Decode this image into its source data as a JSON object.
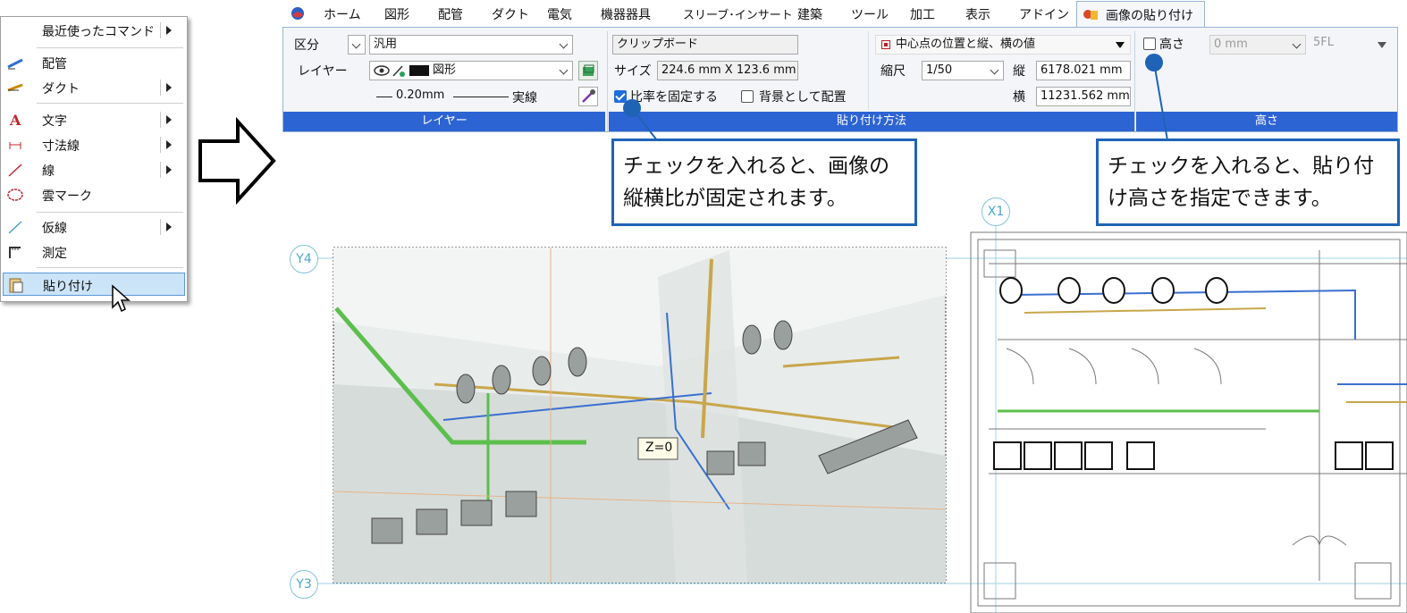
{
  "context_menu": {
    "items": [
      {
        "label": "最近使ったコマンド",
        "submenu": true
      },
      {
        "label": "配管",
        "submenu": false
      },
      {
        "label": "ダクト",
        "submenu": true
      },
      {
        "label": "文字",
        "submenu": true
      },
      {
        "label": "寸法線",
        "submenu": true
      },
      {
        "label": "線",
        "submenu": true
      },
      {
        "label": "雲マーク",
        "submenu": false
      },
      {
        "label": "仮線",
        "submenu": true
      },
      {
        "label": "測定",
        "submenu": false
      },
      {
        "label": "貼り付け",
        "submenu": false
      }
    ]
  },
  "ribbon": {
    "tabs": [
      "ホーム",
      "図形",
      "配管",
      "ダクト",
      "電気",
      "機器器具",
      "スリーブ･インサート",
      "建築",
      "ツール",
      "加工",
      "表示",
      "アドイン"
    ],
    "active_tab": "画像の貼り付け",
    "layer_group": {
      "title": "レイヤー",
      "kubun_label": "区分",
      "kubun_value": "汎用",
      "layer_label": "レイヤー",
      "layer_value": "図形",
      "line_width": "0.20mm",
      "line_type": "実線"
    },
    "paste_group": {
      "title": "貼り付け方法",
      "source": "クリップボード",
      "size_label": "サイズ",
      "size_value": "224.6 mm X 123.6 mm",
      "fix_ratio_label": "比率を固定する",
      "fix_ratio_checked": true,
      "background_label": "背景として配置",
      "background_checked": false,
      "position_mode": "中心点の位置と縦、横の値",
      "scale_label": "縮尺",
      "scale_value": "1/50",
      "height_label": "縦",
      "height_value": "6178.021 mm",
      "width_label": "横",
      "width_value": "11231.562 mm"
    },
    "height_group": {
      "title": "高さ",
      "checkbox_label": "高さ",
      "checked": false,
      "value": "0 mm",
      "reference": "5FL"
    }
  },
  "callouts": {
    "ratio": "チェックを入れると、画像の縦横比が固定されます。",
    "height": "チェックを入れると、貼り付け高さを指定できます。"
  },
  "canvas": {
    "axis_labels": [
      "Y4",
      "Y3",
      "X1"
    ],
    "z_label": "Z=0"
  },
  "colors": {
    "accent": "#2d64d3",
    "callout_border": "#1f63b6",
    "menu_highlight": "#cce4f7",
    "grid_line": "#7fc3de"
  }
}
